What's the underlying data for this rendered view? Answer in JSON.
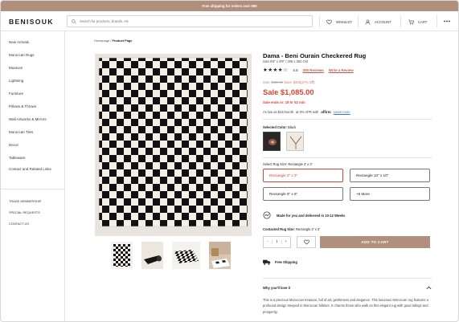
{
  "promo": {
    "text": "Free shipping for orders over $80"
  },
  "header": {
    "logo": "BENISOUK",
    "search_placeholder": "Search for products, brands, etc",
    "wishlist": "WISHLIST",
    "account": "ACCOUNT",
    "cart": "CART"
  },
  "sidebar": {
    "items": [
      "New Arrivals",
      "Moroccan Rugs",
      "Museum",
      "Lightning",
      "Furniture",
      "Pillows & Throws",
      "Wall Artworks & Mirrors",
      "Moroccan Tiles",
      "Decor",
      "Tableware",
      "Contact and Related Links"
    ],
    "secondary": [
      "TRADE MEMBERSHIP",
      "SPECIAL REQUESTS",
      "CONTACT US"
    ]
  },
  "breadcrumb": {
    "home": "Homepage",
    "sep": "/",
    "current": "Product Page"
  },
  "product": {
    "title": "Dama - Beni Ourain Checkered Rug",
    "size": "Size 6'8\" x 9'9\"  /  206 x 302 CM",
    "stars": "★★★★☆",
    "rating": "4.5",
    "reviews": "205 Reviews",
    "write_review": "Write a Review",
    "was_label": "Was:",
    "was_price": "$685.09",
    "save": "Save: $300(27% Off)",
    "sale": "Sale $1,085.00",
    "ends": "Sale ends in: 18 hr  52 min",
    "afford_prefix": "As low as $24/month",
    "afford_mid": "at 0% APR with",
    "affirm": "affirm",
    "learn_more": "Learn more",
    "selected_color_label": "Selected Color:",
    "selected_color": "Black",
    "select_size_label": "Select Rug Size:",
    "select_size_value": "Rectangle 2' x 3'",
    "sizes": [
      "Rectangle 2\" x 3\"",
      "Rectangle 10\" x 10\"",
      "Rectangle 6\" x 6\"",
      "+6 More"
    ],
    "made": "Made for you and delivered in 10-12 Weeks",
    "contacted_label": "Contacted Rug Size:",
    "contacted_value": "Rectangle 2' x 3'",
    "qty_minus": "-",
    "qty": "1",
    "qty_plus": "+",
    "add_to_cart": "ADD TO CART",
    "free_shipping": "Free Shipping",
    "why_title": "Why you'll love it",
    "description": "This is a precious Moroccan treasure, full of art, gentleness and elegance. This luxurious Moroccan rug features a profound design steeped in Moroccan folklore. It charms those who walk on this elegant rug with good tidings and prosperity."
  },
  "colors": {
    "accent": "#b08f7c",
    "sale": "#d84432",
    "link": "#c05a4e"
  }
}
